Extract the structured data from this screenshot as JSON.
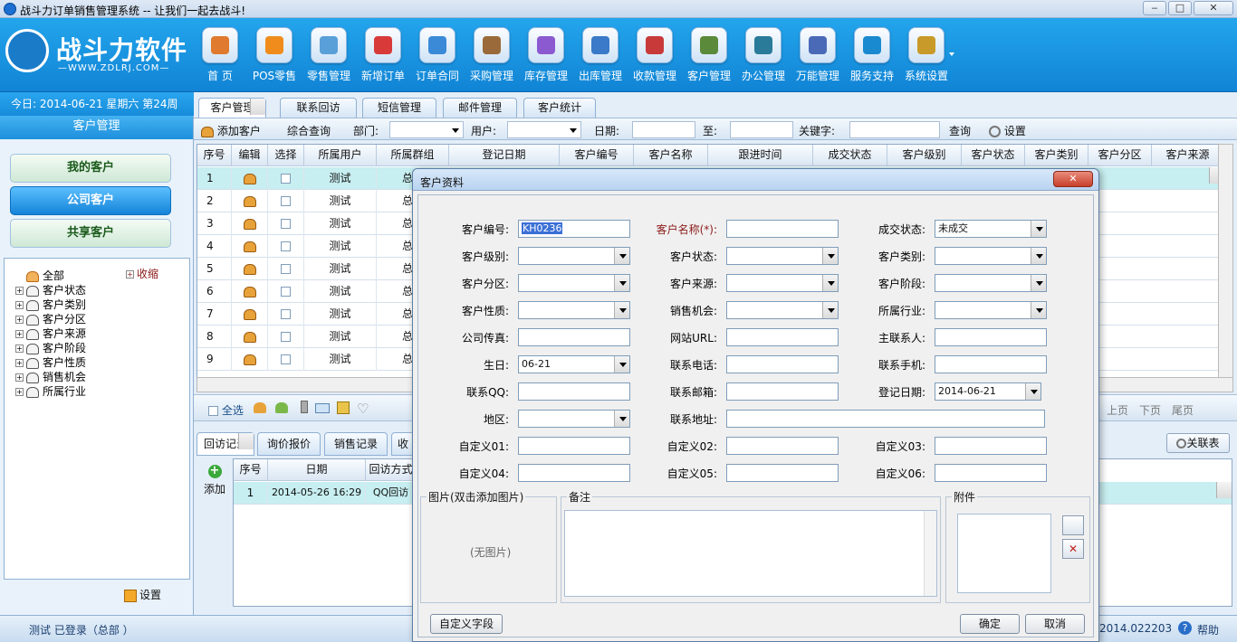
{
  "window": {
    "title": "战斗力订单销售管理系统 -- 让我们一起去战斗!",
    "min": "‒",
    "max": "□",
    "close": "✕"
  },
  "logo": {
    "brand": "战斗力软件",
    "url": "—WWW.ZDLRJ.COM—"
  },
  "toolbar": [
    {
      "label": "首 页",
      "icon": "home-icon",
      "color": "#e07a2e"
    },
    {
      "label": "POS零售",
      "icon": "pos-icon",
      "color": "#f08c1c"
    },
    {
      "label": "零售管理",
      "icon": "retail-icon",
      "color": "#5aa0d8"
    },
    {
      "label": "新增订单",
      "icon": "new-order-icon",
      "color": "#d83a3a"
    },
    {
      "label": "订单合同",
      "icon": "contract-icon",
      "color": "#3a8ad8"
    },
    {
      "label": "采购管理",
      "icon": "purchase-icon",
      "color": "#9a6a3a"
    },
    {
      "label": "库存管理",
      "icon": "stock-icon",
      "color": "#8c5ad0"
    },
    {
      "label": "出库管理",
      "icon": "outbound-icon",
      "color": "#3a7ac8"
    },
    {
      "label": "收款管理",
      "icon": "payment-icon",
      "color": "#c83a3a"
    },
    {
      "label": "客户管理",
      "icon": "customer-icon",
      "color": "#5a8a3a"
    },
    {
      "label": "办公管理",
      "icon": "office-icon",
      "color": "#2a7a9a"
    },
    {
      "label": "万能管理",
      "icon": "universal-icon",
      "color": "#4a6ab8"
    },
    {
      "label": "服务支持",
      "icon": "support-icon",
      "color": "#1a8ad0"
    },
    {
      "label": "系统设置",
      "icon": "gear-icon",
      "color": "#c89a2a"
    }
  ],
  "dateline": "今日: 2014-06-21 星期六 第24周",
  "sidebar": {
    "header": "客户管理",
    "buttons": [
      "我的客户",
      "公司客户",
      "共享客户"
    ],
    "tree": [
      "全部",
      "客户状态",
      "客户类别",
      "客户分区",
      "客户来源",
      "客户阶段",
      "客户性质",
      "销售机会",
      "所属行业"
    ],
    "collapse": "收缩",
    "settings": "设置"
  },
  "tabs": [
    "客户管理",
    "联系回访",
    "短信管理",
    "邮件管理",
    "客户统计"
  ],
  "filter": {
    "add": "添加客户",
    "query": "综合查询",
    "dept": "部门:",
    "user": "用户:",
    "date": "日期:",
    "to": "至:",
    "keyword": "关键字:",
    "search": "查询",
    "settings": "设置"
  },
  "table": {
    "headers": [
      "序号",
      "编辑",
      "选择",
      "所属用户",
      "所属群组",
      "登记日期",
      "客户编号",
      "客户名称",
      "跟进时间",
      "成交状态",
      "客户级别",
      "客户状态",
      "客户类别",
      "客户分区",
      "客户来源"
    ],
    "rows": [
      {
        "n": "1",
        "user": "测试",
        "group": "总"
      },
      {
        "n": "2",
        "user": "测试",
        "group": "总"
      },
      {
        "n": "3",
        "user": "测试",
        "group": "总"
      },
      {
        "n": "4",
        "user": "测试",
        "group": "总"
      },
      {
        "n": "5",
        "user": "测试",
        "group": "总"
      },
      {
        "n": "6",
        "user": "测试",
        "group": "总"
      },
      {
        "n": "7",
        "user": "测试",
        "group": "总"
      },
      {
        "n": "8",
        "user": "测试",
        "group": "总"
      },
      {
        "n": "9",
        "user": "测试",
        "group": "总"
      }
    ]
  },
  "bar2": {
    "selectall": "全选",
    "prev": "上页",
    "next": "下页",
    "last": "尾页"
  },
  "bottom": {
    "tabs": [
      "回访记录",
      "询价报价",
      "销售记录",
      "收"
    ],
    "add": "添加",
    "close": "关联表",
    "headers": [
      "序号",
      "日期",
      "回访方式"
    ],
    "row": {
      "n": "1",
      "date": "2014-05-26 16:29",
      "method": "QQ回访"
    }
  },
  "status": {
    "login": "测试 已登录（总部 ）",
    "version": "2014.022203",
    "help": "帮助"
  },
  "dialog": {
    "title": "客户资料",
    "close": "✕",
    "fields": {
      "khbh": "客户编号:",
      "khmc": "客户名称(*):",
      "cjzt": "成交状态:",
      "khjb": "客户级别:",
      "khzt": "客户状态:",
      "khlb": "客户类别:",
      "khfq": "客户分区:",
      "khly": "客户来源:",
      "khjd": "客户阶段:",
      "khxz": "客户性质:",
      "xsjh": "销售机会:",
      "sshy": "所属行业:",
      "gscz": "公司传真:",
      "wzurl": "网站URL:",
      "zlxr": "主联系人:",
      "sr": "生日:",
      "lxdh": "联系电话:",
      "lxsj": "联系手机:",
      "lxqq": "联系QQ:",
      "lxyx": "联系邮箱:",
      "djrq": "登记日期:",
      "dq": "地区:",
      "lxdz": "联系地址:",
      "zdy01": "自定义01:",
      "zdy02": "自定义02:",
      "zdy03": "自定义03:",
      "zdy04": "自定义04:",
      "zdy05": "自定义05:",
      "zdy06": "自定义06:"
    },
    "values": {
      "khbh": "KH0236",
      "cjzt": "未成交",
      "sr": "06-21",
      "djrq": "2014-06-21"
    },
    "photo_group": "图片(双击添加图片)",
    "no_photo": "(无图片)",
    "remark": "备注",
    "attach": "附件",
    "custom_fields": "自定义字段",
    "ok": "确定",
    "cancel": "取消"
  }
}
